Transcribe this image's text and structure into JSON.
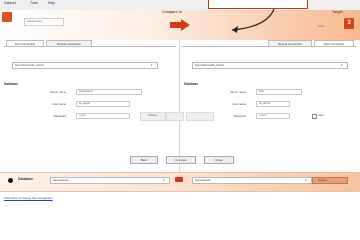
{
  "topbar": {
    "menu": [
      "Dataset",
      "Tools",
      "Help"
    ]
  },
  "header": {
    "db_name": "servername",
    "compare_label": "Compare to",
    "target_label": "Target",
    "host_label": "host",
    "number_badge": "3"
  },
  "left": {
    "tabs": [
      "SQL Connection",
      "Manual Connection"
    ],
    "dropdown": "ServerName\\db_Admin",
    "section": "Database",
    "fields": [
      {
        "label": "Server name",
        "value": "servername"
      },
      {
        "label": "User name",
        "value": "sa_admin"
      },
      {
        "label": "Password",
        "value": "••••••••"
      }
    ],
    "ghost_btn": "Options"
  },
  "right": {
    "tabs": [
      "Manual Connection",
      "SQL Connection"
    ],
    "dropdown": "ServerName\\db_Admin",
    "section": "Database",
    "fields": [
      {
        "label": "Server name",
        "value": "host"
      },
      {
        "label": "User name",
        "value": "sa_admin"
      },
      {
        "label": "Password",
        "value": "••••••••"
      }
    ],
    "remember": "Save"
  },
  "buttons": [
    "Back",
    "Compare",
    "Close"
  ],
  "bottom": {
    "label": "Database",
    "left_select": "ServerName",
    "right_select": "ServerName",
    "right_action": "Options"
  },
  "link": "Click here to change the comparison"
}
